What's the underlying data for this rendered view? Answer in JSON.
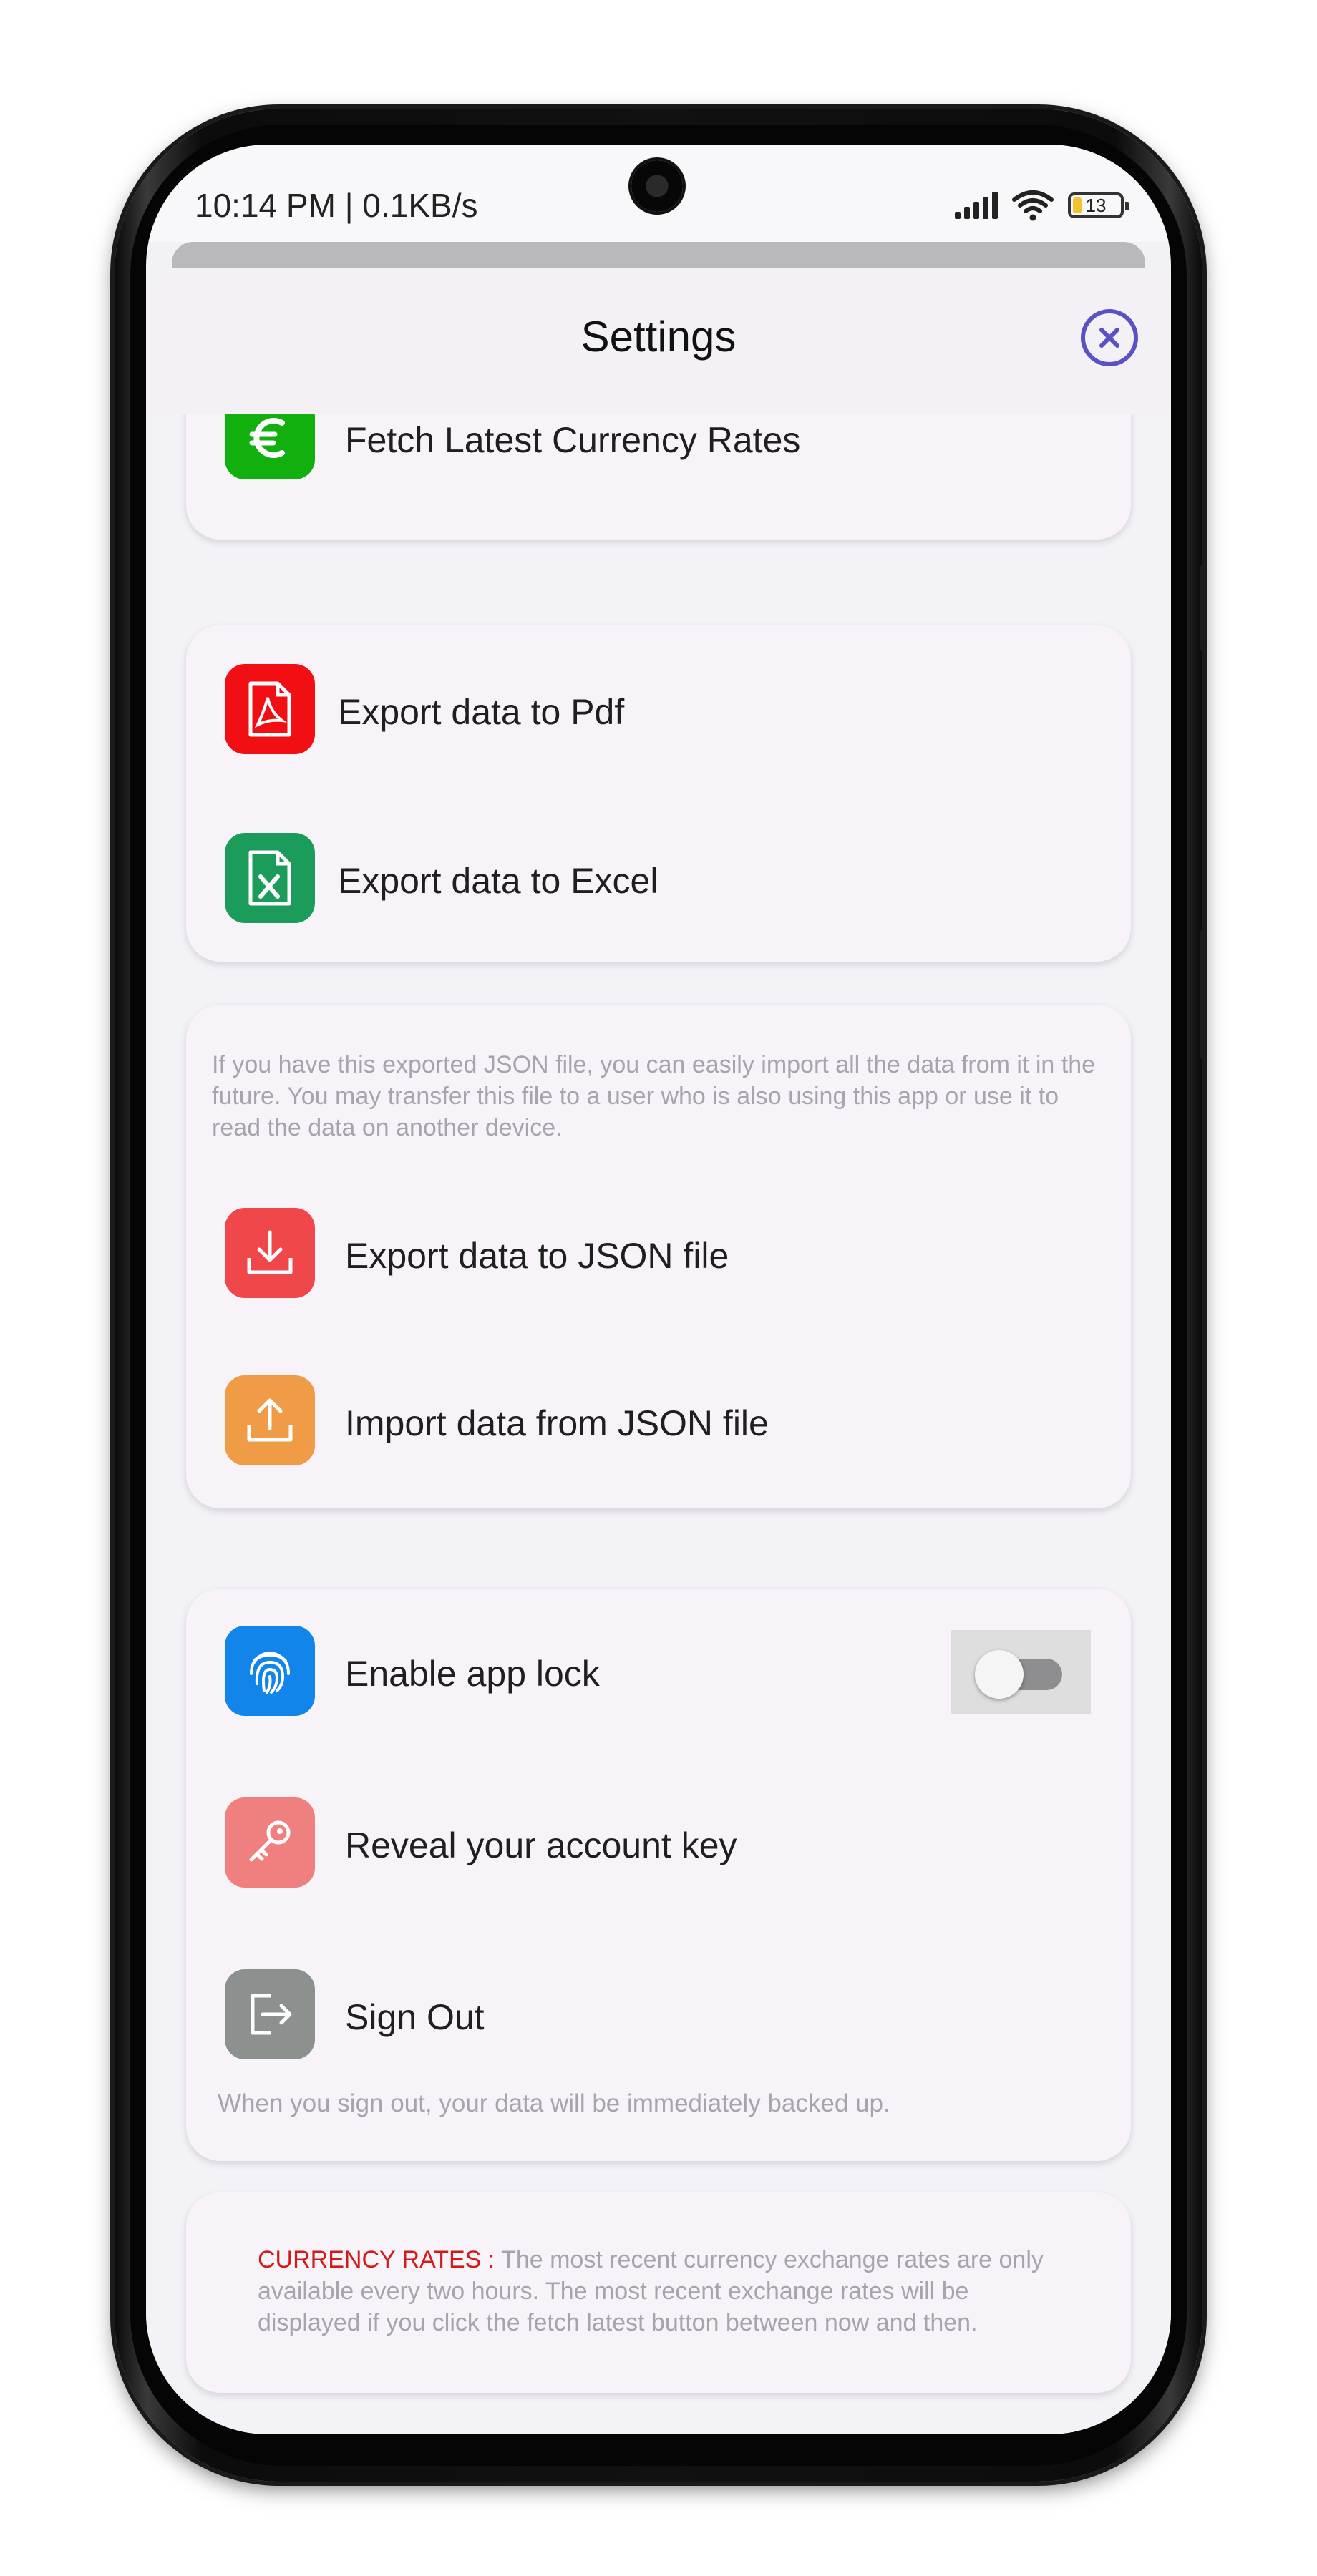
{
  "status_bar": {
    "time": "10:14 PM | 0.1KB/s",
    "battery_level": "13"
  },
  "header": {
    "title": "Settings",
    "close_icon": "close-circle-icon"
  },
  "sections": {
    "currency": {
      "fetch_label": "Fetch Latest Currency Rates",
      "icon": "euro-icon",
      "icon_color": "#12b00f"
    },
    "export": {
      "pdf_label": "Export data to Pdf",
      "pdf_icon_color": "#f20f13",
      "excel_label": "Export data to Excel",
      "excel_icon_color": "#1c9c5b"
    },
    "json": {
      "note": "If you have this exported JSON file, you can easily import all the data from it in the future. You may transfer this file to a user who is also using this app or use it to read the data on another device.",
      "export_label": "Export data to JSON file",
      "export_icon_color": "#f0474b",
      "import_label": "Import data from JSON file",
      "import_icon_color": "#f09c46"
    },
    "account": {
      "app_lock_label": "Enable app lock",
      "app_lock_enabled": false,
      "app_lock_icon_color": "#1285ea",
      "account_key_label": "Reveal your account key",
      "account_key_icon_color": "#f07f7f",
      "sign_out_label": "Sign Out",
      "sign_out_icon_color": "#8c9190",
      "sign_out_note": "When you sign out, your data will be immediately backed up."
    },
    "info": {
      "prefix": "CURRENCY RATES : ",
      "prefix_color": "#d11b1b",
      "text": "The most recent currency exchange rates are only available every two hours. The most recent exchange rates will be displayed if you click the fetch latest button between now and then."
    }
  },
  "colors": {
    "accent": "#5a52c4",
    "sheet_bg": "#f3f2f7",
    "card_bg": "#f7f3f8"
  }
}
